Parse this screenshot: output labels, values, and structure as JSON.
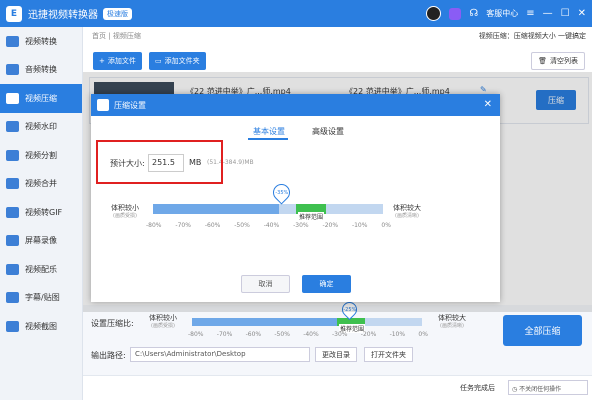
{
  "titlebar": {
    "logo_text": "E",
    "title": "迅捷视频转换器",
    "edition_badge": "极速版",
    "support": "客服中心",
    "window_buttons": [
      "—",
      "☐",
      "✕"
    ]
  },
  "sidebar": {
    "items": [
      {
        "label": "视频转换",
        "icon": "video-convert-icon",
        "active": false
      },
      {
        "label": "音频转换",
        "icon": "audio-convert-icon",
        "active": false
      },
      {
        "label": "视频压缩",
        "icon": "video-compress-icon",
        "active": true
      },
      {
        "label": "视频水印",
        "icon": "watermark-icon",
        "active": false
      },
      {
        "label": "视频分割",
        "icon": "split-icon",
        "active": false
      },
      {
        "label": "视频合并",
        "icon": "merge-icon",
        "active": false
      },
      {
        "label": "视频转GIF",
        "icon": "gif-icon",
        "active": false
      },
      {
        "label": "屏幕录像",
        "icon": "screen-record-icon",
        "active": false
      },
      {
        "label": "视频配乐",
        "icon": "music-icon",
        "active": false
      },
      {
        "label": "字幕/贴图",
        "icon": "subtitle-icon",
        "active": false
      },
      {
        "label": "视频截图",
        "icon": "screenshot-icon",
        "active": false
      }
    ]
  },
  "breadcrumb": {
    "home": "首页",
    "sep": "|",
    "current": "视频压缩",
    "right": "视频压缩：压缩视频大小 一键搞定"
  },
  "toolbar": {
    "add_file": "添加文件",
    "add_folder": "添加文件夹",
    "clear_list": "清空列表"
  },
  "file_row": {
    "name_left": "《22 范进中举》广...师.mp4",
    "name_right": "《22 范进中举》广...师.mp4",
    "compress_button": "压缩"
  },
  "bottom": {
    "ratio_label": "设置压缩比:",
    "small_label": "体积较小",
    "small_sub": "(画质受损)",
    "large_label": "体积较大",
    "large_sub": "(画质清晰)",
    "recommend": "推荐范围",
    "output_label": "输出路径:",
    "output_path": "C:\\Users\\Administrator\\Desktop",
    "change_dir": "更改目录",
    "open_folder": "打开文件夹",
    "compress_all": "全部压缩",
    "task_done_label": "任务完成后",
    "task_done_value": "不关闭任何操作",
    "slider_value": "-25%",
    "ticks": [
      "-80%",
      "-70%",
      "-60%",
      "-50%",
      "-40%",
      "-30%",
      "-20%",
      "-10%",
      "0%"
    ]
  },
  "dialog": {
    "title": "压缩设置",
    "tab_basic": "基本设置",
    "tab_advanced": "高级设置",
    "size_label": "预计大小:",
    "size_value": "251.5",
    "size_unit": "MB",
    "size_range": "(51.4-384.9)MB",
    "small_label": "体积较小",
    "small_sub": "(画质受损)",
    "large_label": "体积较大",
    "large_sub": "(画质清晰)",
    "recommend": "推荐范围",
    "slider_value": "-35%",
    "ticks": [
      "-80%",
      "-70%",
      "-60%",
      "-50%",
      "-40%",
      "-30%",
      "-20%",
      "-10%",
      "0%"
    ],
    "cancel": "取消",
    "confirm": "确定",
    "close": "✕"
  },
  "colors": {
    "accent": "#2a7ee0",
    "highlight_box": "#e02020",
    "recommend": "#3ec04f"
  }
}
